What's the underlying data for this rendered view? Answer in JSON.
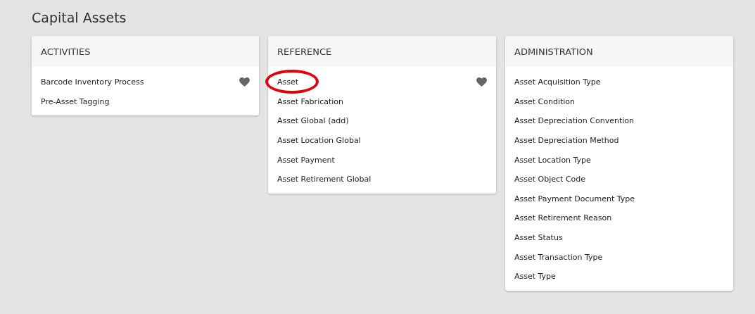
{
  "page_title": "Capital Assets",
  "cards": [
    {
      "title": "ACTIVITIES",
      "items": [
        {
          "label": "Barcode Inventory Process",
          "favorite": true,
          "circled": false
        },
        {
          "label": "Pre-Asset Tagging",
          "favorite": false,
          "circled": false
        }
      ]
    },
    {
      "title": "REFERENCE",
      "items": [
        {
          "label": "Asset",
          "favorite": true,
          "circled": true
        },
        {
          "label": "Asset Fabrication",
          "favorite": false,
          "circled": false
        },
        {
          "label": "Asset Global (add)",
          "favorite": false,
          "circled": false
        },
        {
          "label": "Asset Location Global",
          "favorite": false,
          "circled": false
        },
        {
          "label": "Asset Payment",
          "favorite": false,
          "circled": false
        },
        {
          "label": "Asset Retirement Global",
          "favorite": false,
          "circled": false
        }
      ]
    },
    {
      "title": "ADMINISTRATION",
      "items": [
        {
          "label": "Asset Acquisition Type",
          "favorite": false,
          "circled": false
        },
        {
          "label": "Asset Condition",
          "favorite": false,
          "circled": false
        },
        {
          "label": "Asset Depreciation Convention",
          "favorite": false,
          "circled": false
        },
        {
          "label": "Asset Depreciation Method",
          "favorite": false,
          "circled": false
        },
        {
          "label": "Asset Location Type",
          "favorite": false,
          "circled": false
        },
        {
          "label": "Asset Object Code",
          "favorite": false,
          "circled": false
        },
        {
          "label": "Asset Payment Document Type",
          "favorite": false,
          "circled": false
        },
        {
          "label": "Asset Retirement Reason",
          "favorite": false,
          "circled": false
        },
        {
          "label": "Asset Status",
          "favorite": false,
          "circled": false
        },
        {
          "label": "Asset Transaction Type",
          "favorite": false,
          "circled": false
        },
        {
          "label": "Asset Type",
          "favorite": false,
          "circled": false
        }
      ]
    }
  ]
}
